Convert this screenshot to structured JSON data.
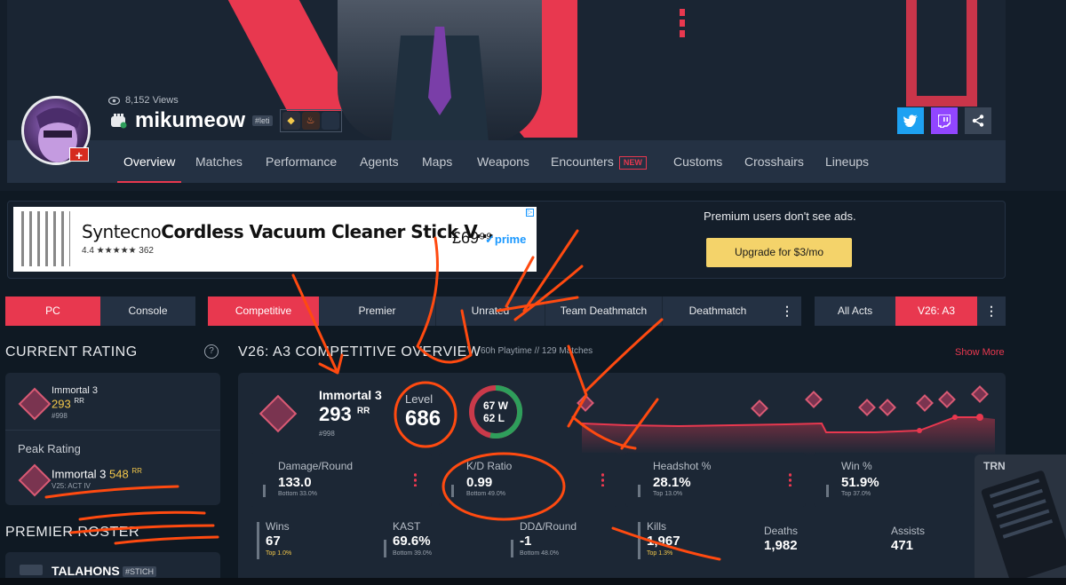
{
  "profile": {
    "views": "8,152 Views",
    "username": "mikumeow",
    "tag": "#leti"
  },
  "nav": {
    "items": [
      "Overview",
      "Matches",
      "Performance",
      "Agents",
      "Maps",
      "Weapons",
      "Encounters",
      "Customs",
      "Crosshairs",
      "Lineups"
    ],
    "new_badge": "NEW",
    "active": "Overview"
  },
  "ad": {
    "brand": "Syntecno",
    "title": "Cordless Vacuum Cleaner Stick V...",
    "rating": "4.4 ★★★★★ 362",
    "price": "£69⁹⁹",
    "prime": "✓prime",
    "premium_text": "Premium users don't see ads.",
    "upgrade_label": "Upgrade for $3/mo"
  },
  "filters": {
    "platforms": [
      "PC",
      "Console"
    ],
    "modes": [
      "Competitive",
      "Premier",
      "Unrated",
      "Team Deathmatch",
      "Deathmatch"
    ],
    "acts": [
      "All Acts",
      "V26: A3"
    ]
  },
  "current_rating": {
    "title": "CURRENT RATING",
    "rank": "Immortal 3",
    "rr": "293",
    "rr_unit": "RR",
    "position": "#998",
    "peak_title": "Peak Rating",
    "peak_rank": "Immortal 3",
    "peak_rr": "548",
    "peak_act": "V25: ACT IV"
  },
  "overview": {
    "title": "V26: A3 COMPETITIVE OVERVIEW",
    "playtime": "60h Playtime",
    "matches": "// 129 Matches",
    "show_more": "Show More",
    "rank": "Immortal 3",
    "rr": "293",
    "rr_unit": "RR",
    "position": "#998",
    "level_label": "Level",
    "level": "686",
    "wins": "67 W",
    "losses": "62 L"
  },
  "stats_top": [
    {
      "label": "Damage/Round",
      "value": "133.0",
      "sub": "Bottom 33.0%"
    },
    {
      "label": "K/D Ratio",
      "value": "0.99",
      "sub": "Bottom 49.0%"
    },
    {
      "label": "Headshot %",
      "value": "28.1%",
      "sub": "Top 13.0%"
    },
    {
      "label": "Win %",
      "value": "51.9%",
      "sub": "Top 37.0%"
    }
  ],
  "stats_bottom": [
    {
      "label": "Wins",
      "value": "67",
      "sub": "Top 1.0%"
    },
    {
      "label": "KAST",
      "value": "69.6%",
      "sub": "Bottom 39.0%"
    },
    {
      "label": "DDΔ/Round",
      "value": "-1",
      "sub": "Bottom 48.0%"
    },
    {
      "label": "Kills",
      "value": "1,967",
      "sub": "Top 1.3%"
    },
    {
      "label": "Deaths",
      "value": "1,982",
      "sub": ""
    },
    {
      "label": "Assists",
      "value": "471",
      "sub": ""
    }
  ],
  "premier": {
    "title": "PREMIER ROSTER",
    "team": "TALAHONS",
    "team_tag": "#STICH"
  },
  "trn_logo": "TRN",
  "colors": {
    "accent": "#e8384f",
    "background": "#0f1923",
    "panel": "#1c2735",
    "gold": "#f4c84a",
    "win": "#2e9e5b"
  }
}
